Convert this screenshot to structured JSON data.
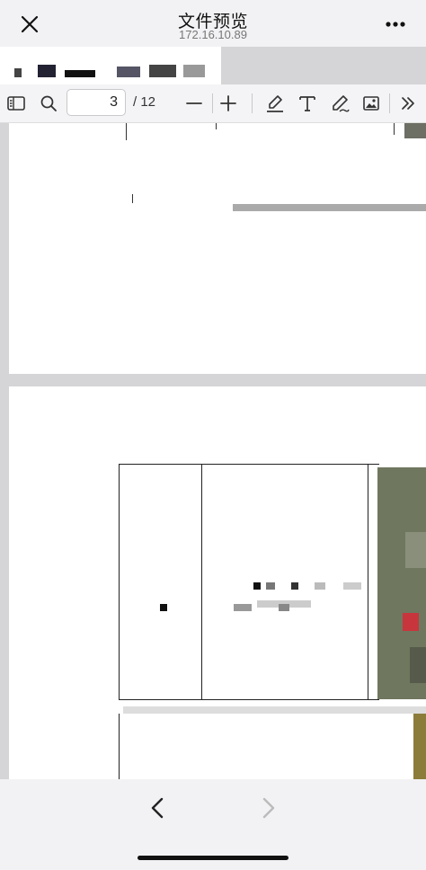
{
  "nav": {
    "title": "文件预览",
    "subtitle": "172.16.10.89",
    "close_icon": "close-icon",
    "more_icon": "more-icon"
  },
  "toolbar": {
    "current_page": "3",
    "total_pages": "/ 12",
    "icons": [
      "sidebar-toggle-icon",
      "search-icon",
      "zoom-out-icon",
      "zoom-in-icon",
      "highlight-icon",
      "text-icon",
      "draw-icon",
      "image-icon",
      "more-tools-icon"
    ]
  },
  "bottom": {
    "back_icon": "chevron-left-icon",
    "forward_icon": "chevron-right-icon"
  },
  "colors": {
    "page_bg": "#ffffff",
    "gutter": "#d5d5d7",
    "bar_bg": "#f2f2f4"
  }
}
